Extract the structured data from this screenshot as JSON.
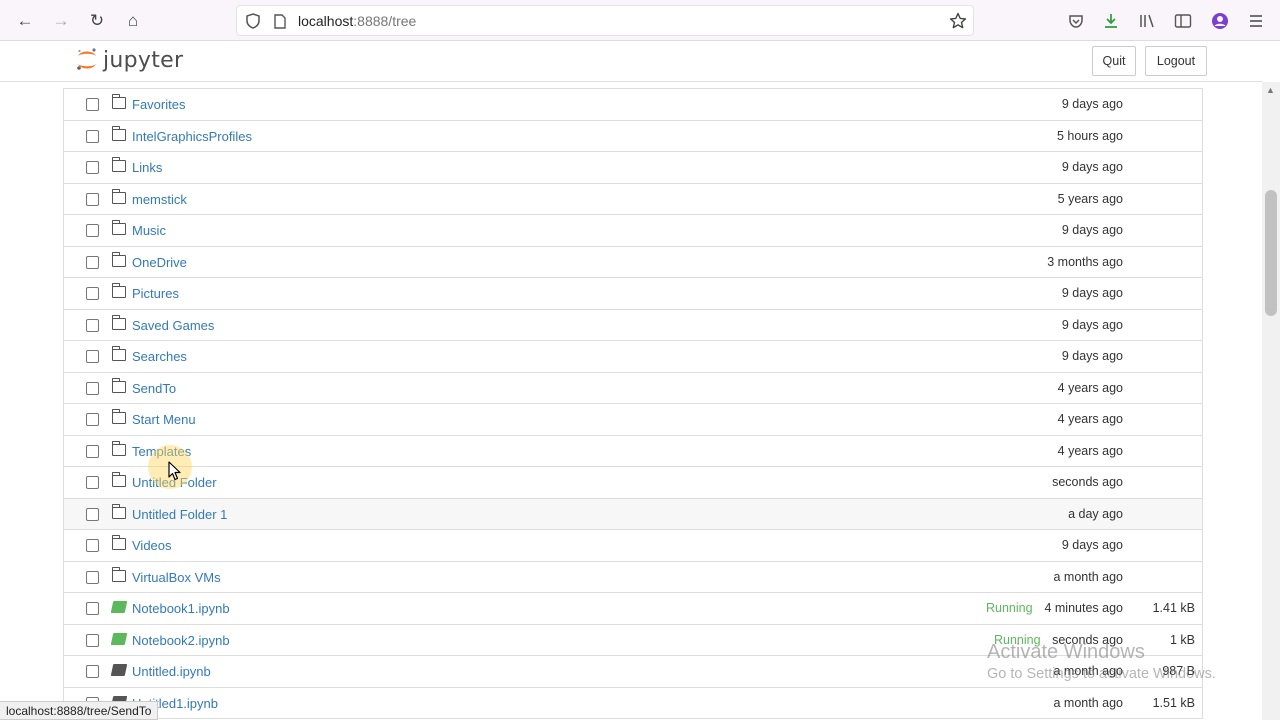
{
  "browser": {
    "url_host": "localhost",
    "url_rest": ":8888/tree",
    "back_label": "←",
    "forward_label": "→",
    "reload_label": "↻",
    "home_label": "⌂"
  },
  "header": {
    "logo_text": "jupyter",
    "quit_label": "Quit",
    "logout_label": "Logout"
  },
  "files": [
    {
      "name": "Favorites",
      "type": "folder",
      "running": "",
      "modified": "9 days ago",
      "size": ""
    },
    {
      "name": "IntelGraphicsProfiles",
      "type": "folder",
      "running": "",
      "modified": "5 hours ago",
      "size": ""
    },
    {
      "name": "Links",
      "type": "folder",
      "running": "",
      "modified": "9 days ago",
      "size": ""
    },
    {
      "name": "memstick",
      "type": "folder",
      "running": "",
      "modified": "5 years ago",
      "size": ""
    },
    {
      "name": "Music",
      "type": "folder",
      "running": "",
      "modified": "9 days ago",
      "size": ""
    },
    {
      "name": "OneDrive",
      "type": "folder",
      "running": "",
      "modified": "3 months ago",
      "size": ""
    },
    {
      "name": "Pictures",
      "type": "folder",
      "running": "",
      "modified": "9 days ago",
      "size": ""
    },
    {
      "name": "Saved Games",
      "type": "folder",
      "running": "",
      "modified": "9 days ago",
      "size": ""
    },
    {
      "name": "Searches",
      "type": "folder",
      "running": "",
      "modified": "9 days ago",
      "size": ""
    },
    {
      "name": "SendTo",
      "type": "folder",
      "running": "",
      "modified": "4 years ago",
      "size": ""
    },
    {
      "name": "Start Menu",
      "type": "folder",
      "running": "",
      "modified": "4 years ago",
      "size": ""
    },
    {
      "name": "Templates",
      "type": "folder",
      "running": "",
      "modified": "4 years ago",
      "size": ""
    },
    {
      "name": "Untitled Folder",
      "type": "folder",
      "running": "",
      "modified": "seconds ago",
      "size": ""
    },
    {
      "name": "Untitled Folder 1",
      "type": "folder",
      "running": "",
      "modified": "a day ago",
      "size": "",
      "highlight": true
    },
    {
      "name": "Videos",
      "type": "folder",
      "running": "",
      "modified": "9 days ago",
      "size": ""
    },
    {
      "name": "VirtualBox VMs",
      "type": "folder",
      "running": "",
      "modified": "a month ago",
      "size": ""
    },
    {
      "name": "Notebook1.ipynb",
      "type": "notebook-running",
      "running": "Running",
      "modified": "4 minutes ago",
      "size": "1.41 kB"
    },
    {
      "name": "Notebook2.ipynb",
      "type": "notebook-running",
      "running": "Running",
      "modified": "seconds ago",
      "size": "1 kB"
    },
    {
      "name": "Untitled.ipynb",
      "type": "notebook",
      "running": "",
      "modified": "a month ago",
      "size": "987 B"
    },
    {
      "name": "Untitled1.ipynb",
      "type": "notebook",
      "running": "",
      "modified": "a month ago",
      "size": "1.51 kB"
    }
  ],
  "status_url": "localhost:8888/tree/SendTo",
  "watermark": {
    "line1": "Activate Windows",
    "line2": "Go to Settings to activate Windows."
  },
  "colors": {
    "link": "#337ab7",
    "running": "#5cb85c",
    "logo_orange": "#f37726"
  }
}
